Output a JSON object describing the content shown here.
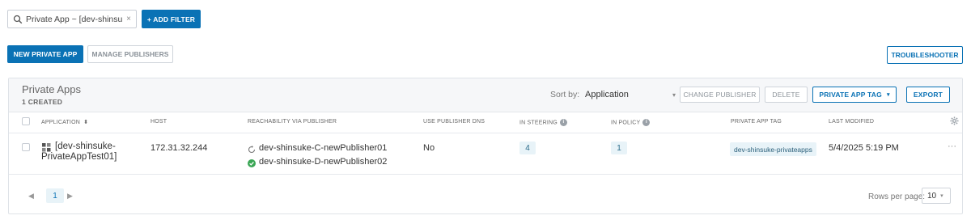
{
  "filters": {
    "chip_text": "Private App ~ [dev-shinsuke-P...",
    "remove_glyph": "×",
    "add_filter_label": "+ ADD FILTER"
  },
  "toolbar": {
    "new_app_label": "NEW PRIVATE APP",
    "manage_publishers_label": "MANAGE PUBLISHERS",
    "troubleshooter_label": "TROUBLESHOOTER"
  },
  "panel": {
    "title": "Private Apps",
    "subtitle": "1 CREATED",
    "sort_label": "Sort by:",
    "sort_value": "Application",
    "change_publisher_label": "CHANGE PUBLISHER",
    "delete_label": "DELETE",
    "private_app_tag_label": "PRIVATE APP TAG",
    "export_label": "EXPORT"
  },
  "table": {
    "columns": {
      "application": "APPLICATION",
      "host": "HOST",
      "reachability": "REACHABILITY VIA PUBLISHER",
      "use_publisher_dns": "USE PUBLISHER DNS",
      "in_steering": "IN STEERING",
      "in_policy": "IN POLICY",
      "private_app_tag": "PRIVATE APP TAG",
      "last_modified": "LAST MODIFIED"
    },
    "rows": [
      {
        "app_line1": "[dev-shinsuke-",
        "app_line2": "PrivateAppTest01]",
        "host": "172.31.32.244",
        "publisher1": "dev-shinsuke-C-newPublisher01",
        "publisher2": "dev-shinsuke-D-newPublisher02",
        "use_publisher_dns": "No",
        "in_steering": "4",
        "in_policy": "1",
        "tag": "dev-shinsuke-privateapps",
        "last_modified": "5/4/2025 5:19 PM",
        "more": "···"
      }
    ]
  },
  "pager": {
    "prev": "◀",
    "page": "1",
    "next": "▶",
    "rows_label": "Rows per page:",
    "rows_value": "10"
  },
  "colors": {
    "primary": "#0a72b5",
    "pill_bg": "#e8f3f8",
    "success": "#3aa655"
  },
  "icons": {
    "search": "search-icon",
    "sort": "sort-icon",
    "info": "info-icon",
    "settings": "gear-icon",
    "app": "app-grid-icon",
    "pending": "sync-icon",
    "connected": "check-circle-icon"
  }
}
